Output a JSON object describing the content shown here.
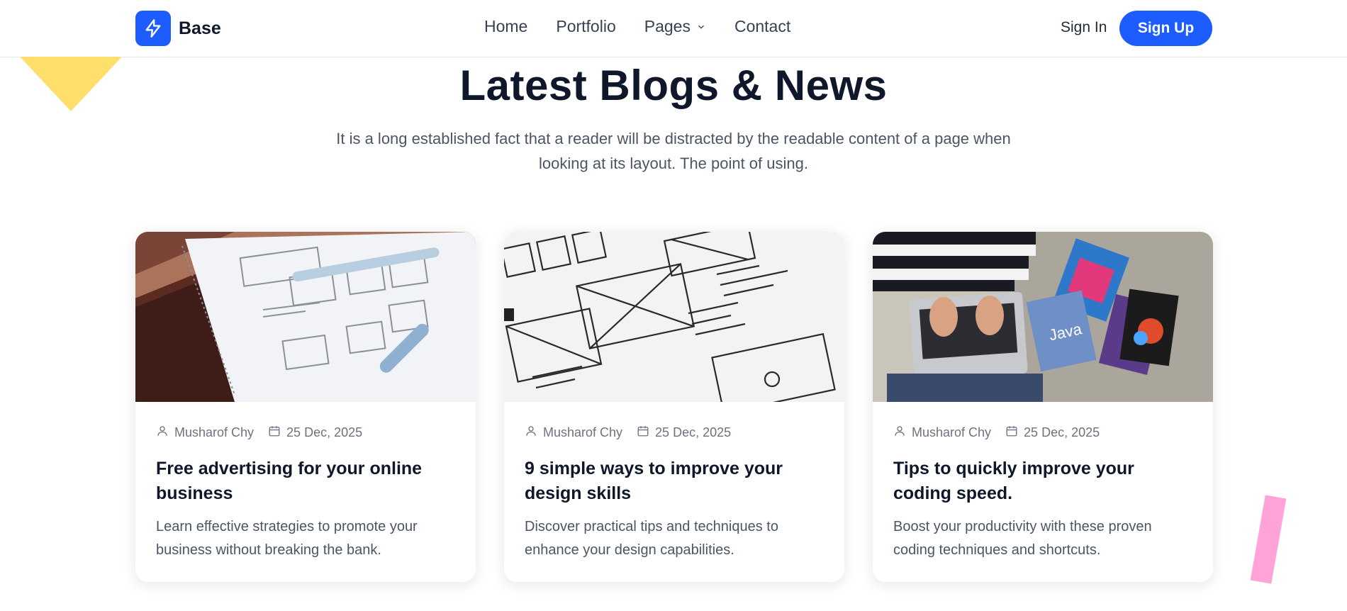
{
  "header": {
    "logo_text": "Base",
    "nav": [
      "Home",
      "Portfolio",
      "Pages",
      "Contact"
    ],
    "signin_label": "Sign In",
    "signup_label": "Sign Up"
  },
  "section": {
    "title": "Latest Blogs & News",
    "subtitle": "It is a long established fact that a reader will be distracted by the readable content of a page when looking at its layout. The point of using."
  },
  "cards": [
    {
      "author": "Musharof Chy",
      "date": "25 Dec, 2025",
      "title": "Free advertising for your online business",
      "description": "Learn effective strategies to promote your business without breaking the bank."
    },
    {
      "author": "Musharof Chy",
      "date": "25 Dec, 2025",
      "title": "9 simple ways to improve your design skills",
      "description": "Discover practical tips and techniques to enhance your design capabilities."
    },
    {
      "author": "Musharof Chy",
      "date": "25 Dec, 2025",
      "title": "Tips to quickly improve your coding speed.",
      "description": "Boost your productivity with these proven coding techniques and shortcuts."
    }
  ],
  "colors": {
    "brand": "#1d5cff",
    "deco_yellow": "#ffdf6b",
    "deco_pink": "#ffa3d8"
  },
  "icons": {
    "logo": "bolt-icon",
    "pages_dropdown": "chevron-down-icon",
    "author": "user-icon",
    "date": "calendar-icon"
  }
}
